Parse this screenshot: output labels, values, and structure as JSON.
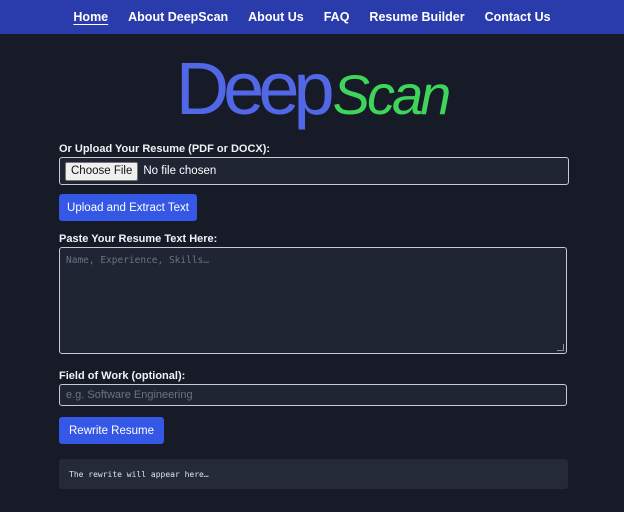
{
  "nav": {
    "items": [
      "Home",
      "About DeepScan",
      "About Us",
      "FAQ",
      "Resume Builder",
      "Contact Us"
    ],
    "active": "Home"
  },
  "logo": {
    "part1": "Deep",
    "part2": "Scan"
  },
  "upload": {
    "label": "Or Upload Your Resume (PDF or DOCX):",
    "choose_button": "Choose File",
    "file_status": "No file chosen",
    "extract_button": "Upload and Extract Text"
  },
  "paste": {
    "label": "Paste Your Resume Text Here:",
    "placeholder": "Name, Experience, Skills…"
  },
  "field": {
    "label": "Field of Work (optional):",
    "placeholder": "e.g. Software Engineering"
  },
  "rewrite_button": "Rewrite Resume",
  "output": {
    "text": "The rewrite will appear here…"
  },
  "colors": {
    "nav_bg": "#2a3cab",
    "page_bg": "#161b27",
    "logo_deep": "#5167e6",
    "logo_scan": "#3fd45a",
    "button": "#3457e6"
  }
}
